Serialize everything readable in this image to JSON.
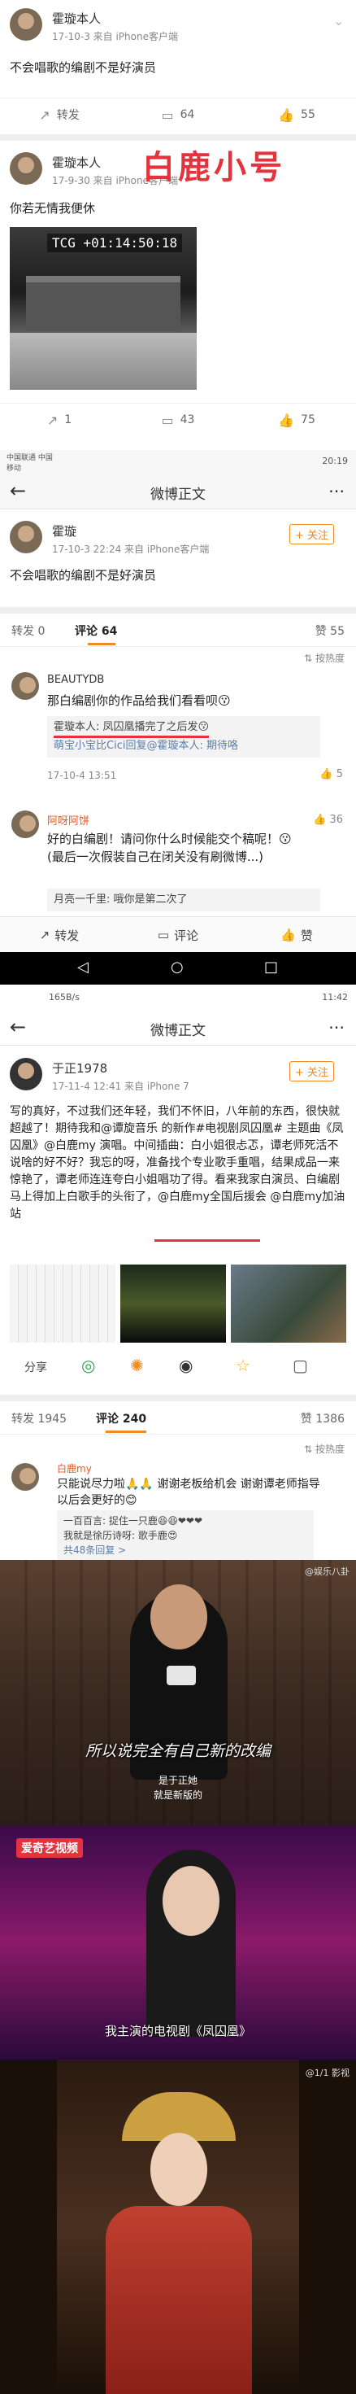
{
  "post1": {
    "name": "霍璇本人",
    "meta": "17-10-3 来自 iPhone客户端",
    "text": "不会唱歌的编剧不是好演员",
    "repost": "转发",
    "comments": "64",
    "likes": "55"
  },
  "post2": {
    "name": "霍璇本人",
    "meta": "17-9-30 来自 iPhone客户端",
    "watermark": "白鹿小号",
    "text": "你若无情我便休",
    "tc": "TCG +01:14:50:18",
    "repost": "1",
    "comments": "43",
    "likes": "75"
  },
  "status1": {
    "left": "中国联通 中国移动",
    "right": "20:19"
  },
  "detail1": {
    "title": "微博正文",
    "name": "霍璇",
    "meta": "17-10-3 22:24 来自 iPhone客户端",
    "follow": "+ 关注",
    "text": "不会唱歌的编剧不是好演员",
    "tab_repost": "转发 0",
    "tab_comment": "评论 64",
    "tab_like": "赞 55",
    "sort": "按热度"
  },
  "comment1": {
    "name": "BEAUTYDB",
    "text": "那白编剧你的作品给我们看看呗😗",
    "reply1": "霍璇本人: 凤囚凰播完了之后发😗",
    "reply2": "萌宝小宝比Cici回复@霍璇本人: 期待咯",
    "time": "17-10-4 13:51",
    "likes": "5"
  },
  "comment2": {
    "name": "阿呀阿饼",
    "text": "好的白编剧！请问你什么时候能交个稿呢！😗(最后一次假装自己在闭关没有刷微博...)",
    "reply": "月亮一千里: 哦你是第二次了",
    "likes": "36"
  },
  "bottombar1": {
    "repost": "转发",
    "comment": "评论",
    "like": "赞"
  },
  "status2": {
    "left": "165B/s",
    "right": "11:42"
  },
  "detail2": {
    "title": "微博正文",
    "name": "于正1978",
    "meta": "17-11-4 12:41 来自 iPhone 7",
    "follow": "+ 关注",
    "text": "写的真好，不过我们还年轻，我们不怀旧，八年前的东西，很快就超越了！期待我和@谭旋音乐 的新作#电视剧凤囚凰# 主题曲《凤囚凰》@白鹿my 演唱。中间插曲：白小姐很忐忑，谭老师死活不说啥的好不好？我忘的呀，准备找个专业歌手重唱，结果成品一来惊艳了，谭老师连连夸白小姐唱功了得。看来我家白演员、白编剧马上得加上白歌手的头衔了，@白鹿my全国后援会 @白鹿my加油站",
    "share": "分享",
    "tab_repost": "转发 1945",
    "tab_comment": "评论 240",
    "tab_like": "赞 1386",
    "sort": "按热度"
  },
  "comment3": {
    "name": "白鹿my",
    "text": "只能说尽力啦🙏🙏 谢谢老板给机会 谢谢谭老师指导 以后会更好的😊",
    "reply1": "一百百言: 捉住一只鹿😆😆❤❤❤",
    "reply2": "我就是徐历诗呀: 歌手鹿😍",
    "more": "共48条回复 >"
  },
  "video1": {
    "subtitle": "所以说完全有自己新的改编",
    "caption1": "是于正她",
    "caption2": "就是新版的",
    "watermark": "@娱乐八卦"
  },
  "video2": {
    "logo": "爱奇艺视频",
    "caption": "我主演的电视剧《凤囚凰》"
  },
  "video3": {
    "watermark": "@1/1 影视"
  }
}
